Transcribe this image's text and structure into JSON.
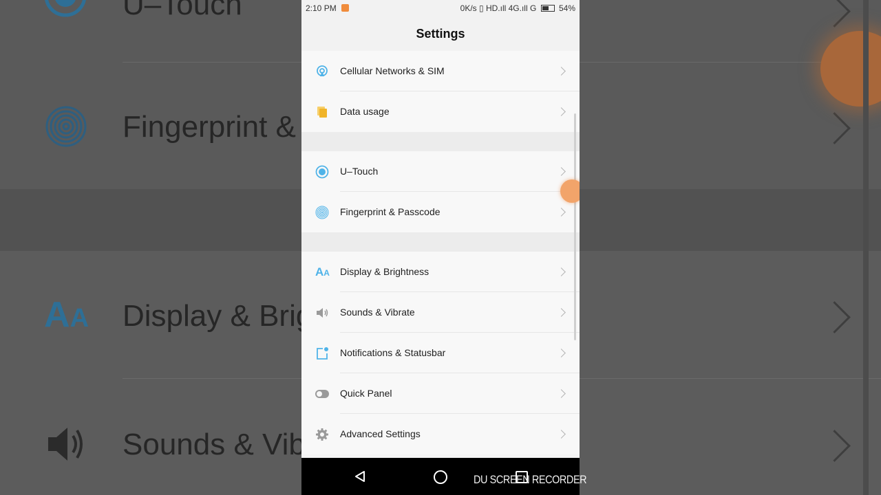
{
  "status_bar": {
    "time": "2:10 PM",
    "right": "0K/s ▯ HD.ıll 4G.ıll G",
    "battery": "54%"
  },
  "header": {
    "title": "Settings"
  },
  "background_zoom": {
    "row1": "U–Touch",
    "row2": "Fingerprint &",
    "row3": "Display & Brig",
    "row4": "Sounds & Vib"
  },
  "settings": {
    "groups": [
      {
        "items": [
          {
            "label": "Cellular Networks & SIM",
            "icon": "cellular-network-icon",
            "color": "#4fb3e8"
          },
          {
            "label": "Data usage",
            "icon": "data-usage-icon",
            "color": "#f0b429"
          }
        ]
      },
      {
        "items": [
          {
            "label": "U–Touch",
            "icon": "u-touch-icon",
            "color": "#4fb3e8"
          },
          {
            "label": "Fingerprint & Passcode",
            "icon": "fingerprint-icon",
            "color": "#4fb3e8"
          }
        ]
      },
      {
        "items": [
          {
            "label": "Display & Brightness",
            "icon": "display-brightness-icon",
            "color": "#4fb3e8"
          },
          {
            "label": "Sounds & Vibrate",
            "icon": "speaker-icon",
            "color": "#9a9a9a"
          },
          {
            "label": "Notifications & Statusbar",
            "icon": "notification-icon",
            "color": "#4fb3e8"
          },
          {
            "label": "Quick Panel",
            "icon": "toggle-icon",
            "color": "#9a9a9a"
          },
          {
            "label": "Advanced Settings",
            "icon": "gear-icon",
            "color": "#9a9a9a"
          }
        ]
      }
    ]
  },
  "watermark": "DU SCREEN RECORDER",
  "colors": {
    "accent": "#4fb3e8",
    "orange": "#f0b429",
    "recorder_ball": "#f2a46a"
  }
}
